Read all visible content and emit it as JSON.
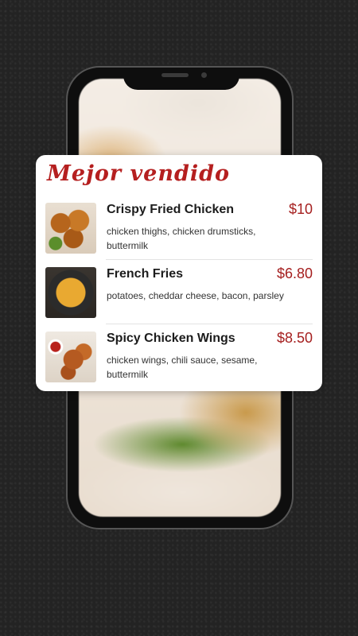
{
  "card": {
    "title": "Mejor vendido"
  },
  "items": [
    {
      "name": "Crispy Fried Chicken",
      "price": "$10",
      "description": "chicken thighs, chicken drumsticks, buttermilk",
      "image": "fried-chicken-photo"
    },
    {
      "name": "French Fries",
      "price": "$6.80",
      "description": "potatoes, cheddar cheese, bacon, parsley",
      "image": "french-fries-photo"
    },
    {
      "name": "Spicy Chicken Wings",
      "price": "$8.50",
      "description": "chicken wings, chili sauce, sesame, buttermilk",
      "image": "chicken-wings-photo"
    }
  ],
  "colors": {
    "accent": "#b51f1f",
    "price": "#a51f1f",
    "background": "#232323"
  }
}
